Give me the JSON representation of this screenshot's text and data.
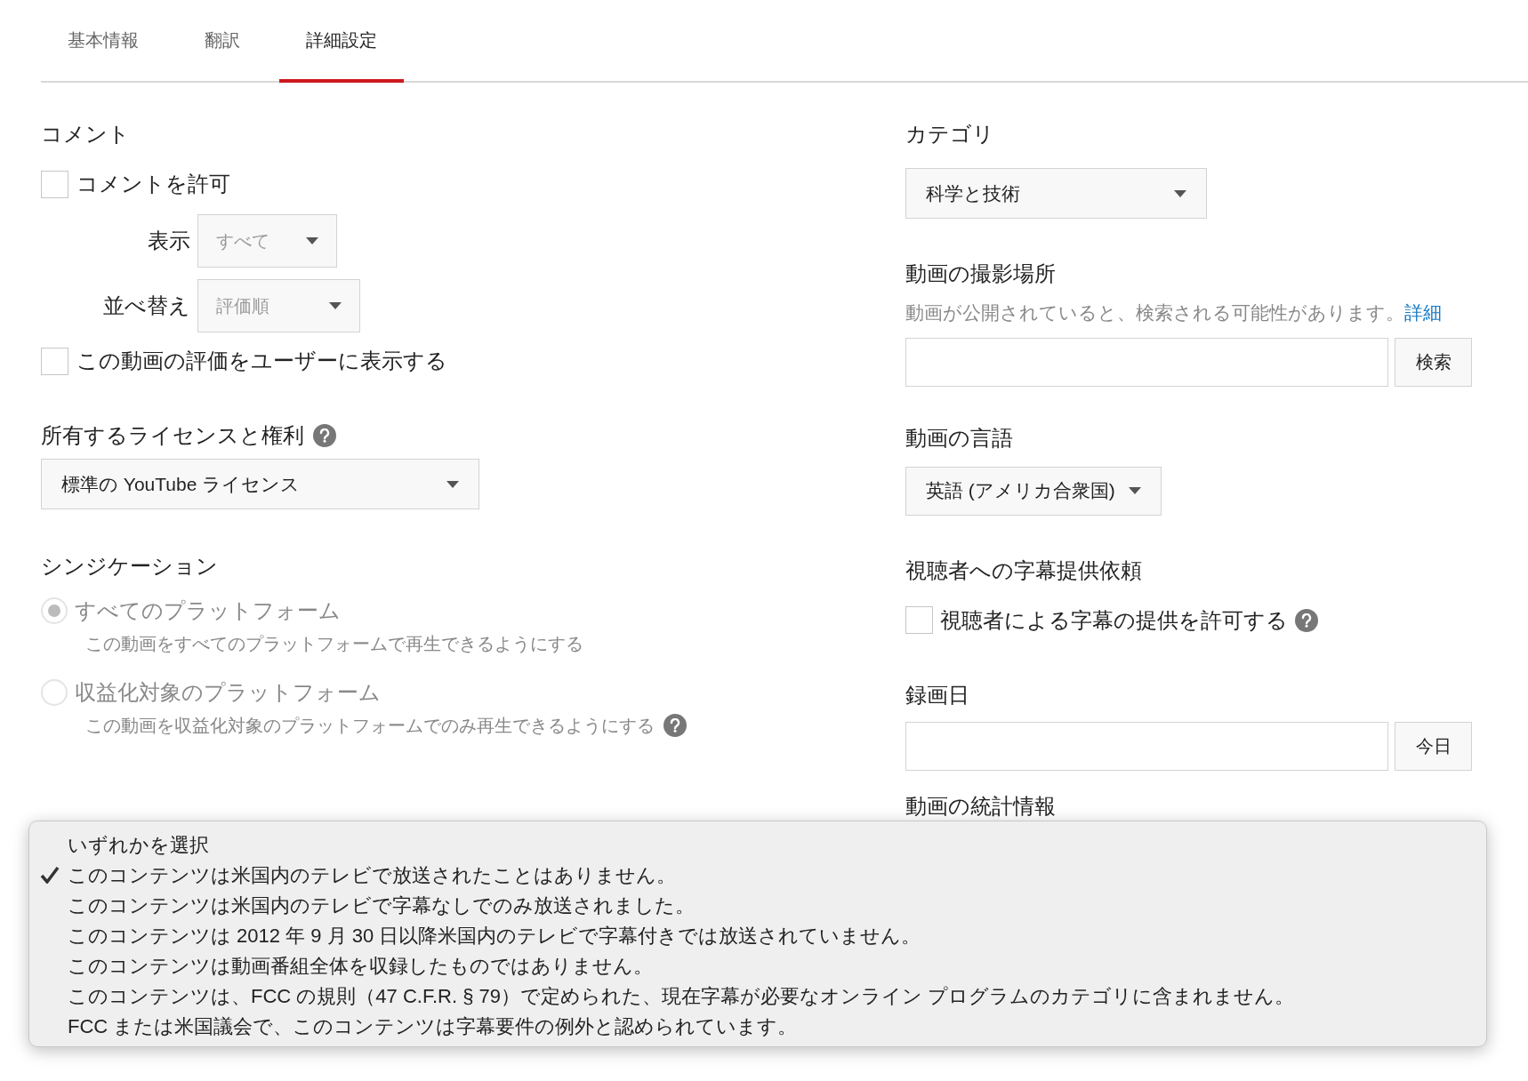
{
  "tabs": [
    {
      "label": "基本情報",
      "selected": false
    },
    {
      "label": "翻訳",
      "selected": false
    },
    {
      "label": "詳細設定",
      "selected": true
    }
  ],
  "comments": {
    "heading": "コメント",
    "allow": {
      "label": "コメントを許可",
      "checked": false
    },
    "display": {
      "label": "表示",
      "value": "すべて",
      "disabled": true
    },
    "sort": {
      "label": "並べ替え",
      "value": "評価順",
      "disabled": true
    },
    "show_ratings": {
      "label": "この動画の評価をユーザーに表示する",
      "checked": false
    }
  },
  "license": {
    "heading": "所有するライセンスと権利",
    "value": "標準の YouTube ライセンス"
  },
  "syndication": {
    "heading": "シンジケーション",
    "options": [
      {
        "label": "すべてのプラットフォーム",
        "description": "この動画をすべてのプラットフォームで再生できるようにする",
        "selected": true,
        "help": false
      },
      {
        "label": "収益化対象のプラットフォーム",
        "description": "この動画を収益化対象のプラットフォームでのみ再生できるようにする",
        "selected": false,
        "help": true
      }
    ]
  },
  "category": {
    "heading": "カテゴリ",
    "value": "科学と技術"
  },
  "location": {
    "heading": "動画の撮影場所",
    "description": "動画が公開されていると、検索される可能性があります。",
    "link": "詳細",
    "button": "検索"
  },
  "language": {
    "heading": "動画の言語",
    "value": "英語 (アメリカ合衆国)"
  },
  "community": {
    "heading": "視聴者への字幕提供依頼",
    "label": "視聴者による字幕の提供を許可する",
    "checked": false
  },
  "recording_date": {
    "heading": "録画日",
    "button": "今日"
  },
  "stats": {
    "heading": "動画の統計情報"
  },
  "menu": [
    {
      "label": "いずれかを選択",
      "selected": false
    },
    {
      "label": "このコンテンツは米国内のテレビで放送されたことはありません。",
      "selected": true
    },
    {
      "label": "このコンテンツは米国内のテレビで字幕なしでのみ放送されました。",
      "selected": false
    },
    {
      "label": "このコンテンツは 2012 年 9 月 30 日以降米国内のテレビで字幕付きでは放送されていません。",
      "selected": false
    },
    {
      "label": "このコンテンツは動画番組全体を収録したものではありません。",
      "selected": false
    },
    {
      "label": "このコンテンツは、FCC の規則（47 C.F.R. § 79）で定められた、現在字幕が必要なオンライン プログラムのカテゴリに含まれません。",
      "selected": false
    },
    {
      "label": "FCC または米国議会で、このコンテンツは字幕要件の例外と認められています。",
      "selected": false
    }
  ]
}
